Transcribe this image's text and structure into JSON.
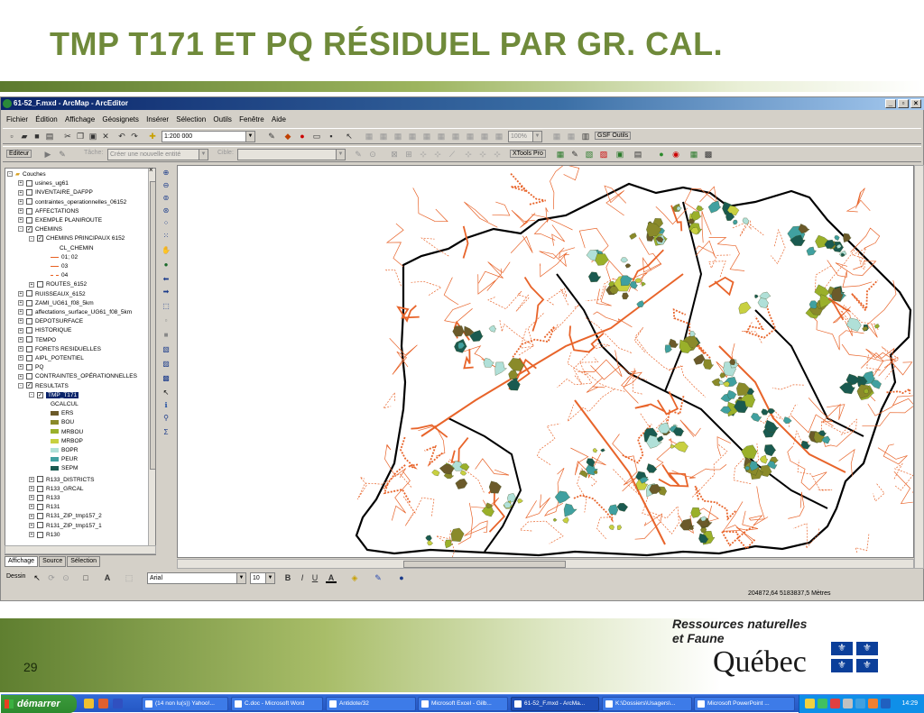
{
  "slide": {
    "title": "TMP T171 ET PQ RÉSIDUEL PAR GR. CAL.",
    "page_number": "29",
    "logo": {
      "line1": "Ressources naturelles",
      "line2": "et Faune",
      "wordmark": "Québec"
    }
  },
  "window": {
    "title": "61-52_F.mxd - ArcMap - ArcEditor",
    "buttons": [
      "_",
      "▫",
      "×"
    ]
  },
  "menu": [
    "Fichier",
    "Édition",
    "Affichage",
    "Géosignets",
    "Insérer",
    "Sélection",
    "Outils",
    "Fenêtre",
    "Aide"
  ],
  "toolbar1": {
    "scale": "1:200 000",
    "zoom_percent": "100%",
    "gsf_label": "GSF Outils"
  },
  "toolbar2": {
    "editor_label": "Editeur",
    "task_label": "Tâche:",
    "task_value": "Créer une nouvelle entité",
    "target_label": "Cible:",
    "xtools_label": "XTools Pro"
  },
  "toc": {
    "root": "Couches",
    "layers": [
      {
        "name": "usines_ug61",
        "checked": false
      },
      {
        "name": "INVENTAIRE_DAFPP",
        "checked": false
      },
      {
        "name": "contraintes_operationnelles_06152",
        "checked": false
      },
      {
        "name": "AFFECTATIONS",
        "checked": false
      },
      {
        "name": "EXEMPLE PLANIROUTE",
        "checked": false
      },
      {
        "name": "CHEMINS",
        "checked": true
      }
    ],
    "chemins_sub": {
      "name": "CHEMINS PRINCIPAUX 6152",
      "field": "CL_CHEMIN",
      "classes": [
        "01; 02",
        "03",
        "04"
      ]
    },
    "layers2": [
      {
        "name": "ROUTES_6152",
        "checked": false
      },
      {
        "name": "RUISSEAUX_6152",
        "checked": false
      },
      {
        "name": "ZAMI_UG61_f08_5km",
        "checked": false
      },
      {
        "name": "affectations_surface_UG61_f08_5km",
        "checked": false
      },
      {
        "name": "DEPOTSURFACE",
        "checked": false
      },
      {
        "name": "HISTORIQUE",
        "checked": false
      },
      {
        "name": "TEMPO",
        "checked": false
      },
      {
        "name": "FORETS RESIDUELLES",
        "checked": false
      },
      {
        "name": "AIPL_POTENTIEL",
        "checked": false
      },
      {
        "name": "PQ",
        "checked": false
      },
      {
        "name": "CONTRAINTES_OPÉRATIONNELLES",
        "checked": false
      },
      {
        "name": "RESULTATS",
        "checked": true
      }
    ],
    "tmp_layer": "TMP_T171",
    "gcalcul_field": "GCALCUL",
    "gcalcul_classes": [
      {
        "label": "ERS",
        "color": "#6b5a2a"
      },
      {
        "label": "BOU",
        "color": "#8a8a2a"
      },
      {
        "label": "MRBOU",
        "color": "#9ab02a"
      },
      {
        "label": "MRBOP",
        "color": "#c8d040"
      },
      {
        "label": "BOPR",
        "color": "#b0e0d8"
      },
      {
        "label": "PEUR",
        "color": "#40a0a0"
      },
      {
        "label": "SEPM",
        "color": "#1a5a50"
      }
    ],
    "layers3": [
      {
        "name": "R133_DISTRICTS",
        "checked": false
      },
      {
        "name": "R133_GRCAL",
        "checked": false
      },
      {
        "name": "R133",
        "checked": false
      },
      {
        "name": "R131",
        "checked": false
      },
      {
        "name": "R131_ZIP_tmp157_2",
        "checked": false
      },
      {
        "name": "R131_ZIP_tmp157_1",
        "checked": false
      },
      {
        "name": "R130",
        "checked": false
      }
    ],
    "tabs": [
      "Affichage",
      "Source",
      "Sélection"
    ]
  },
  "drawing": {
    "dessin_label": "Dessin",
    "font": "Arial",
    "size": "10",
    "bold": "B",
    "italic": "I",
    "underline": "U"
  },
  "status": {
    "coords": "204872,64  5183837,5 Mètres"
  },
  "taskbar": {
    "start": "démarrer",
    "tasks": [
      {
        "label": "(14 non lu(s)) Yahoo!...",
        "active": false
      },
      {
        "label": "C.doc - Microsoft Word",
        "active": false
      },
      {
        "label": "Antidote/32",
        "active": false
      },
      {
        "label": "Microsoft Excel - Gilb...",
        "active": false
      },
      {
        "label": "61-52_F.mxd - ArcMa...",
        "active": true
      },
      {
        "label": "K:\\Dossiers\\Usagers\\...",
        "active": false
      },
      {
        "label": "Microsoft PowerPoint ...",
        "active": false
      }
    ],
    "clock": "14:29"
  },
  "colors": {
    "title_green": "#6f8a3a",
    "road_orange": "#e8642a",
    "boundary_black": "#000000"
  }
}
